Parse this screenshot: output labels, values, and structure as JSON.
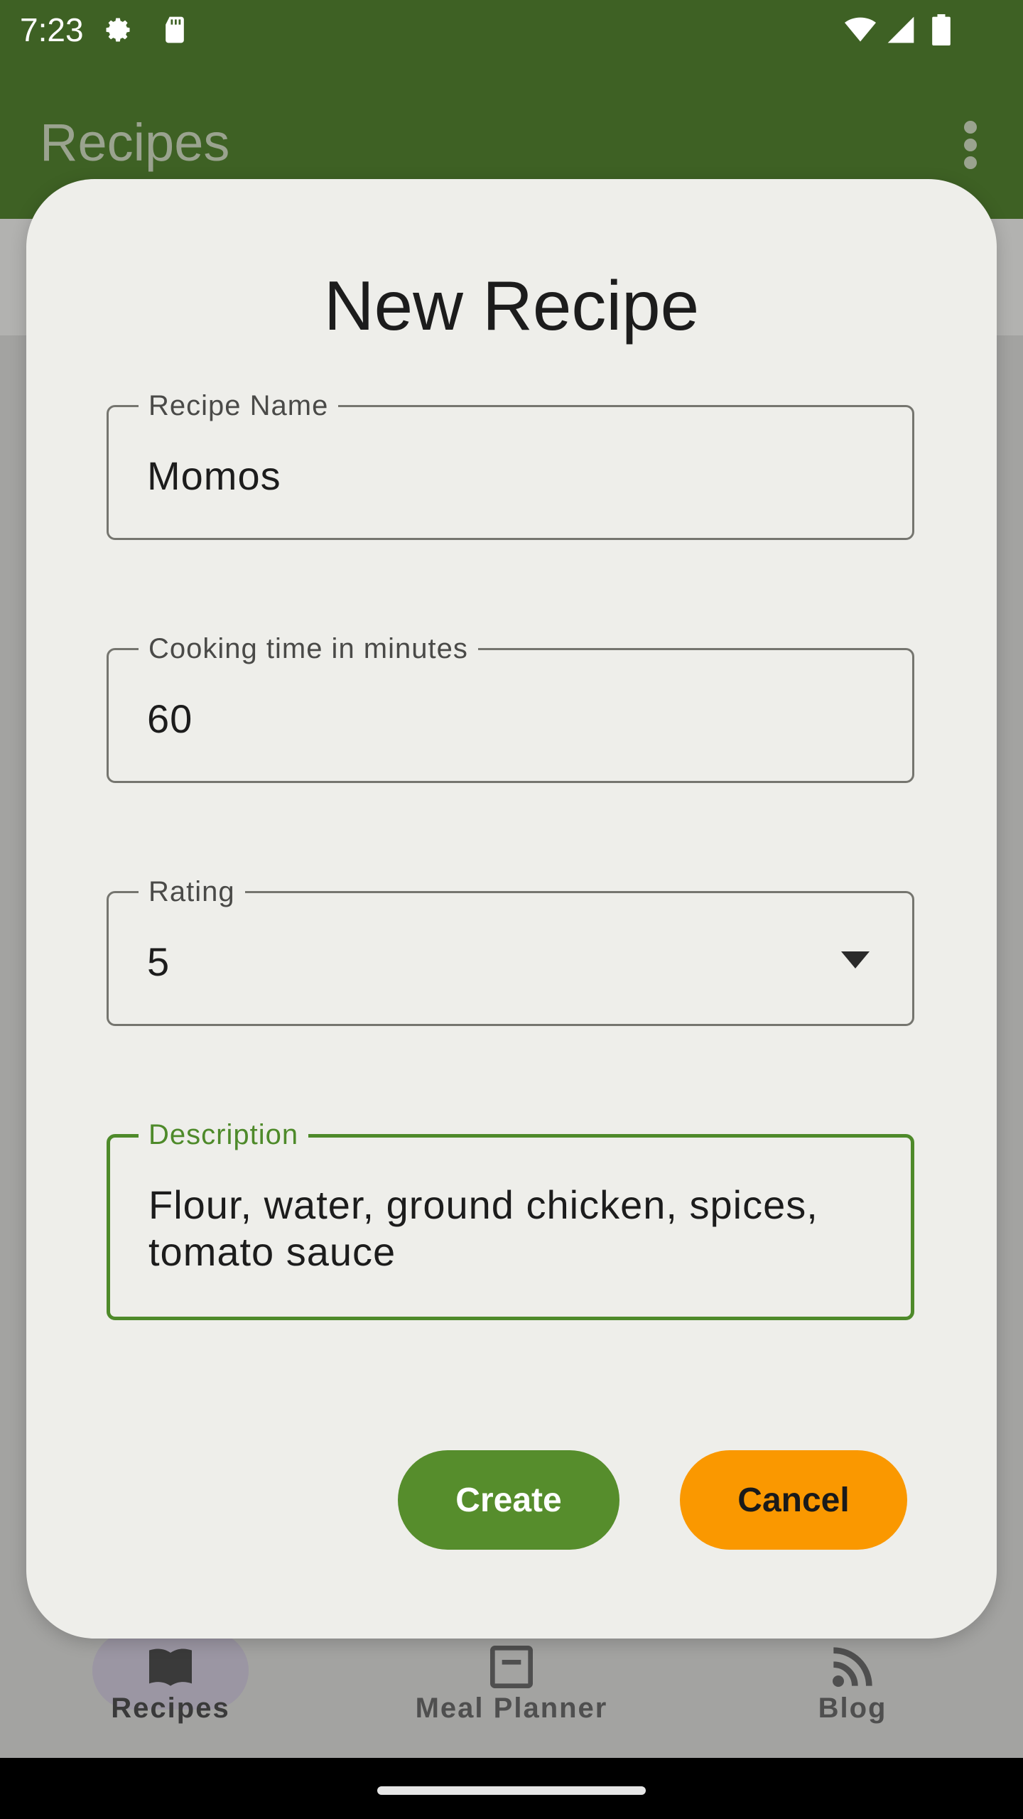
{
  "status_bar": {
    "time": "7:23",
    "icons": [
      "settings-icon",
      "sd-card-icon",
      "wifi-icon",
      "cell-signal-icon",
      "battery-icon"
    ]
  },
  "app_bar": {
    "title": "Recipes",
    "menu_icon": "more-vert-icon"
  },
  "bottom_nav": {
    "items": [
      {
        "label": "Recipes",
        "icon": "book-icon",
        "selected": true
      },
      {
        "label": "Meal Planner",
        "icon": "planner-icon",
        "selected": false
      },
      {
        "label": "Blog",
        "icon": "rss-icon",
        "selected": false
      }
    ]
  },
  "dialog": {
    "title": "New Recipe",
    "fields": {
      "name": {
        "label": "Recipe Name",
        "value": "Momos"
      },
      "time": {
        "label": "Cooking time in minutes",
        "value": "60"
      },
      "rating": {
        "label": "Rating",
        "value": "5"
      },
      "description": {
        "label": "Description",
        "value": "Flour, water, ground chicken, spices, tomato sauce"
      }
    },
    "create_label": "Create",
    "cancel_label": "Cancel"
  },
  "colors": {
    "app_bar": "#3e6124",
    "dialog_bg": "#eeeeea",
    "focus_green": "#4e8a2a",
    "create_button": "#568d2c",
    "cancel_button": "#fa9800"
  }
}
